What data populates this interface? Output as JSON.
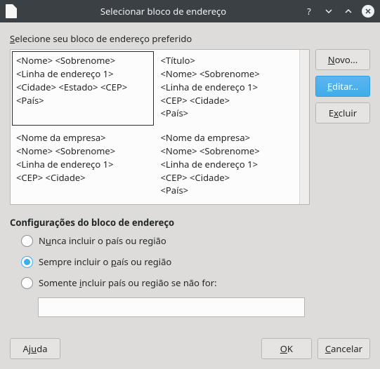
{
  "titlebar": {
    "title": "Selecionar bloco de endereço"
  },
  "labels": {
    "select_block": "Selecione seu bloco de endereço preferido",
    "settings_header": "Configurações do bloco de endereço"
  },
  "blocks": [
    "<Nome> <Sobrenome>\n<Linha de endereço 1>\n<Cidade> <Estado> <CEP>\n<País>",
    "<Título>\n<Nome> <Sobrenome>\n<Linha de endereço 1>\n<CEP> <Cidade>\n<País>",
    "<Nome da empresa>\n<Nome> <Sobrenome>\n<Linha de endereço 1>\n<CEP> <Cidade>",
    "<Nome da empresa>\n<Nome> <Sobrenome>\n<Linha de endereço 1>\n<CEP> <Cidade>\n<País>"
  ],
  "side_buttons": {
    "new": "Novo...",
    "edit": "Editar...",
    "delete": "Excluir"
  },
  "radios": {
    "never": "Nunca incluir o país ou região",
    "always": "Sempre incluir o país ou região",
    "only_if": "Somente incluir país ou região se não for:"
  },
  "country_value": "",
  "footer": {
    "help": "Ajuda",
    "ok": "OK",
    "cancel": "Cancelar"
  }
}
